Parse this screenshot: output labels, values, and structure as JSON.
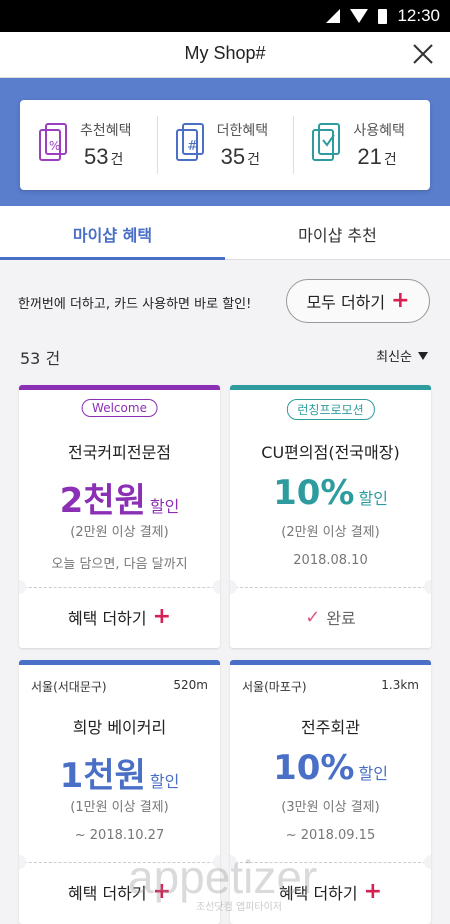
{
  "status_bar": {
    "time": "12:30"
  },
  "header": {
    "title": "My Shop#"
  },
  "stats": [
    {
      "label": "추천혜택",
      "count": "53",
      "unit": "건"
    },
    {
      "label": "더한혜택",
      "count": "35",
      "unit": "건"
    },
    {
      "label": "사용혜택",
      "count": "21",
      "unit": "건"
    }
  ],
  "tabs": [
    {
      "label": "마이샵 혜택"
    },
    {
      "label": "마이샵 추천"
    }
  ],
  "promo": {
    "text": "한꺼번에 더하고, 카드 사용하면 바로 할인!",
    "button_label": "모두 더하기",
    "plus": "+"
  },
  "list": {
    "count": "53 건",
    "sort_label": "최신순"
  },
  "cards": [
    {
      "badge": "Welcome",
      "store": "전국커피전문점",
      "amount": "2천원",
      "unit": "할인",
      "condition": "(2만원 이상 결제)",
      "note": "오늘 담으면, 다음 달까지",
      "action": "혜택 더하기",
      "plus": "+"
    },
    {
      "badge": "런칭프로모션",
      "store": "CU편의점(전국매장)",
      "amount": "10%",
      "unit": "할인",
      "condition": "(2만원 이상 결제)",
      "note": "2018.08.10",
      "action": "완료",
      "check": "✓"
    },
    {
      "location": "서울(서대문구)",
      "distance": "520m",
      "store": "희망 베이커리",
      "amount": "1천원",
      "unit": "할인",
      "condition": "(1만원 이상 결제)",
      "note": "~ 2018.10.27",
      "action": "혜택 더하기",
      "plus": "+"
    },
    {
      "location": "서울(마포구)",
      "distance": "1.3km",
      "store": "전주회관",
      "amount": "10%",
      "unit": "할인",
      "condition": "(3만원 이상 결제)",
      "note": "~ 2018.09.15",
      "action": "혜택 더하기",
      "plus": "+"
    }
  ],
  "watermark": {
    "logo": "appetizer",
    "sub": "조선닷컴 앱피타이저"
  },
  "colors": {
    "banner": "#5a7dcc",
    "accent_blue": "#4a6fc6",
    "purple": "#8b2fb5",
    "teal": "#2e9c9e",
    "plus_red": "#d62052"
  }
}
